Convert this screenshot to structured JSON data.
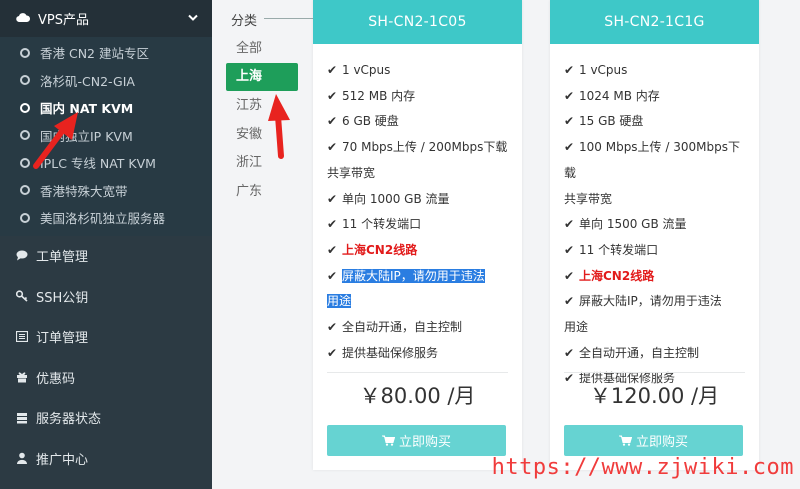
{
  "sidebar": {
    "header": {
      "label": "VPS产品"
    },
    "sub_items": [
      {
        "label": "香港 CN2 建站专区",
        "active": false
      },
      {
        "label": "洛杉矶-CN2-GIA",
        "active": false
      },
      {
        "label": "国内 NAT KVM",
        "active": true
      },
      {
        "label": "国内独立IP KVM",
        "active": false
      },
      {
        "label": "IPLC 专线 NAT KVM",
        "active": false
      },
      {
        "label": "香港特殊大宽带",
        "active": false
      },
      {
        "label": "美国洛杉矶独立服务器",
        "active": false
      }
    ],
    "menu_items": [
      {
        "label": "工单管理",
        "icon": "comment-icon"
      },
      {
        "label": "SSH公钥",
        "icon": "key-icon"
      },
      {
        "label": "订单管理",
        "icon": "list-icon"
      },
      {
        "label": "优惠码",
        "icon": "gift-icon"
      },
      {
        "label": "服务器状态",
        "icon": "server-icon"
      },
      {
        "label": "推广中心",
        "icon": "user-icon"
      }
    ]
  },
  "category": {
    "title": "分类",
    "items": [
      "全部",
      "上海",
      "江苏",
      "安徽",
      "浙江",
      "广东"
    ],
    "active": "上海"
  },
  "products": [
    {
      "name": "SH-CN2-1C05",
      "features": [
        "1 vCpus",
        "512 MB 内存",
        "6 GB 硬盘",
        "70 Mbps上传 / 200Mbps下载",
        "共享带宽",
        "单向 1000 GB 流量",
        "11 个转发端口",
        "上海CN2线路",
        "屏蔽大陆IP，请勿用于违法",
        "用途",
        "全自动开通，自主控制",
        "提供基础保修服务"
      ],
      "price": "￥80.00 /月",
      "buy_label": "立即购买"
    },
    {
      "name": "SH-CN2-1C1G",
      "features": [
        "1 vCpus",
        "1024 MB 内存",
        "15 GB 硬盘",
        "100 Mbps上传 / 300Mbps下载",
        "共享带宽",
        "单向 1500 GB 流量",
        "11 个转发端口",
        "上海CN2线路",
        "屏蔽大陆IP，请勿用于违法",
        "用途",
        "全自动开通，自主控制",
        "提供基础保修服务"
      ],
      "price": "￥120.00 /月",
      "buy_label": "立即购买"
    }
  ],
  "watermark": "https://www.zjwiki.com",
  "colors": {
    "sidebar_bg": "#2c3a43",
    "accent_teal": "#3ec8c8",
    "active_green": "#1e9e5a",
    "red": "#e21b1b",
    "highlight": "#2a7de1"
  }
}
